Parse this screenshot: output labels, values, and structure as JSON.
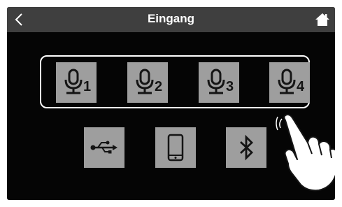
{
  "header": {
    "title": "Eingang",
    "back_icon": "chevron-left-icon",
    "home_icon": "home-icon"
  },
  "mic_inputs": [
    {
      "number": "1",
      "icon": "microphone-icon"
    },
    {
      "number": "2",
      "icon": "microphone-icon"
    },
    {
      "number": "3",
      "icon": "microphone-icon"
    },
    {
      "number": "4",
      "icon": "microphone-icon"
    }
  ],
  "sources": [
    {
      "icon": "usb-icon"
    },
    {
      "icon": "smartphone-icon"
    },
    {
      "icon": "bluetooth-icon"
    }
  ],
  "colors": {
    "screen_bg": "#050505",
    "titlebar_bg": "#3f3f3f",
    "button_bg": "#9e9e9e",
    "highlight_border": "#ffffff"
  }
}
